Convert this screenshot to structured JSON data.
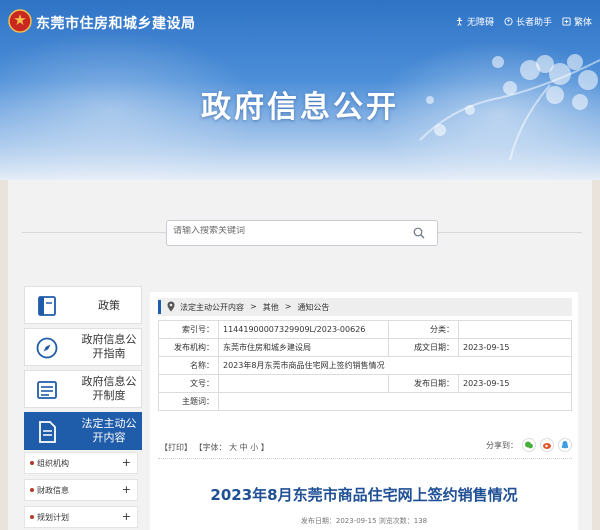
{
  "header": {
    "site_name": "东莞市住房和城乡建设局",
    "links": [
      {
        "label": "无障碍",
        "icon": "accessibility-icon"
      },
      {
        "label": "长者助手",
        "icon": "elder-assistant-icon"
      },
      {
        "label": "繁体",
        "icon": "traditional-chinese-icon"
      }
    ],
    "banner_title": "政府信息公开"
  },
  "search": {
    "placeholder": "请输入搜索关键词",
    "icon": "search-icon"
  },
  "sidebar": {
    "items": [
      {
        "label": "政策",
        "icon": "book-icon"
      },
      {
        "label": "政府信息公开指南",
        "icon": "compass-icon"
      },
      {
        "label": "政府信息公开制度",
        "icon": "list-icon"
      },
      {
        "label": "法定主动公开内容",
        "icon": "document-icon",
        "active": true
      }
    ],
    "sub_items": [
      {
        "label": "组织机构",
        "expand": "+"
      },
      {
        "label": "财政信息",
        "expand": "+"
      },
      {
        "label": "规划计划",
        "expand": "+"
      }
    ]
  },
  "breadcrumb": [
    "法定主动公开内容",
    ">",
    "其他",
    ">",
    "通知公告"
  ],
  "meta": {
    "index_label": "索引号：",
    "index_value": "11441900007329909L/2023-00626",
    "category_label": "分类：",
    "category_value": "",
    "publisher_label": "发布机构：",
    "publisher_value": "东莞市住房和城乡建设局",
    "created_label": "成文日期：",
    "created_value": "2023-09-15",
    "name_label": "名称：",
    "name_value": "2023年8月东莞市商品住宅网上签约销售情况",
    "docno_label": "文号：",
    "docno_value": "",
    "published_label": "发布日期：",
    "published_value": "2023-09-15",
    "keywords_label": "主题词：",
    "keywords_value": ""
  },
  "tools": {
    "print": "【打印】",
    "font": "【字体：",
    "large": "大",
    "medium": "中",
    "small": "小",
    "close": "】"
  },
  "share": {
    "label": "分享到："
  },
  "document": {
    "title": "2023年8月东莞市商品住宅网上签约销售情况",
    "pub_info": "发布日期：2023-09-15 浏览次数：138"
  },
  "colors": {
    "primary": "#1f5ca9",
    "title": "#1f4f95",
    "accent_red": "#b23a2e"
  }
}
